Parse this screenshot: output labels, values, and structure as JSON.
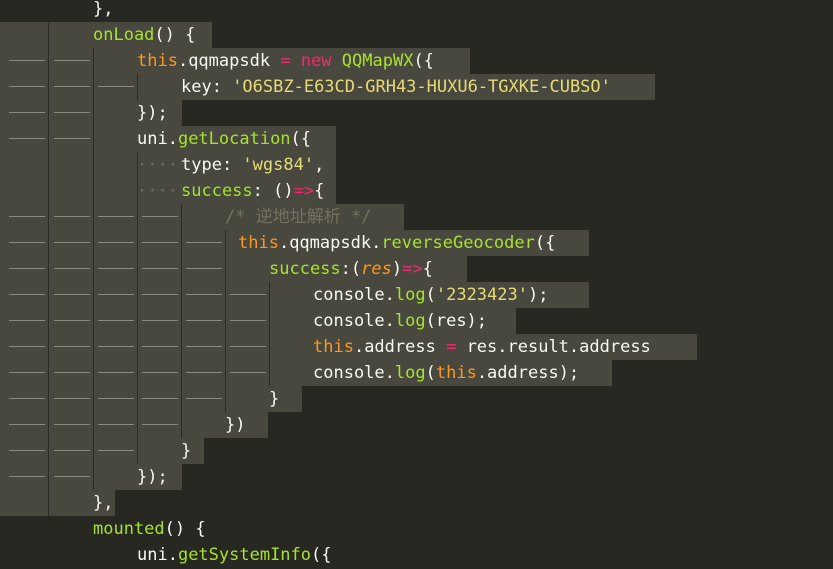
{
  "editor": {
    "colors": {
      "background": "#272822",
      "selection": "#49483e",
      "keyword": "#f92672",
      "function": "#a6e22e",
      "string": "#e6db74",
      "this": "#fd971f",
      "comment": "#75715e",
      "text": "#f8f8f2"
    },
    "lines": [
      [
        {
          "t": "},",
          "k": "pl"
        }
      ],
      [
        {
          "t": "onLoad",
          "k": "fn"
        },
        {
          "t": "() {",
          "k": "pl"
        }
      ],
      [
        {
          "t": "this",
          "k": "th"
        },
        {
          "t": ".qqmapsdk ",
          "k": "pl"
        },
        {
          "t": "=",
          "k": "kw"
        },
        {
          "t": " ",
          "k": "pl"
        },
        {
          "t": "new",
          "k": "kw"
        },
        {
          "t": " ",
          "k": "pl"
        },
        {
          "t": "QQMapWX",
          "k": "fn"
        },
        {
          "t": "({",
          "k": "pl"
        }
      ],
      [
        {
          "t": "key: ",
          "k": "pl"
        },
        {
          "t": "'O6SBZ-E63CD-GRH43-HUXU6-TGXKE-CUBSO'",
          "k": "str"
        }
      ],
      [
        {
          "t": "});",
          "k": "pl"
        }
      ],
      [
        {
          "t": "uni.",
          "k": "pl"
        },
        {
          "t": "getLocation",
          "k": "fn"
        },
        {
          "t": "({",
          "k": "pl"
        }
      ],
      [
        {
          "t": "type: ",
          "k": "pl"
        },
        {
          "t": "'wgs84'",
          "k": "str"
        },
        {
          "t": ",",
          "k": "pl"
        }
      ],
      [
        {
          "t": "success",
          "k": "fn"
        },
        {
          "t": ": ()",
          "k": "pl"
        },
        {
          "t": "=>",
          "k": "kw"
        },
        {
          "t": "{",
          "k": "pl"
        }
      ],
      [
        {
          "t": "/* 逆地址解析 */",
          "k": "cm"
        }
      ],
      [
        {
          "t": "this",
          "k": "th"
        },
        {
          "t": ".qqmapsdk.",
          "k": "pl"
        },
        {
          "t": "reverseGeocoder",
          "k": "fn"
        },
        {
          "t": "({",
          "k": "pl"
        }
      ],
      [
        {
          "t": "success",
          "k": "fn"
        },
        {
          "t": ":(",
          "k": "pl"
        },
        {
          "t": "res",
          "k": "prm"
        },
        {
          "t": ")",
          "k": "pl"
        },
        {
          "t": "=>",
          "k": "kw"
        },
        {
          "t": "{",
          "k": "pl"
        }
      ],
      [
        {
          "t": "console.",
          "k": "pl"
        },
        {
          "t": "log",
          "k": "fn"
        },
        {
          "t": "(",
          "k": "pl"
        },
        {
          "t": "'2323423'",
          "k": "str"
        },
        {
          "t": ");",
          "k": "pl"
        }
      ],
      [
        {
          "t": "console.",
          "k": "pl"
        },
        {
          "t": "log",
          "k": "fn"
        },
        {
          "t": "(res);",
          "k": "pl"
        }
      ],
      [
        {
          "t": "this",
          "k": "th"
        },
        {
          "t": ".address ",
          "k": "pl"
        },
        {
          "t": "=",
          "k": "kw"
        },
        {
          "t": " res.result.address",
          "k": "pl"
        }
      ],
      [
        {
          "t": "console.",
          "k": "pl"
        },
        {
          "t": "log",
          "k": "fn"
        },
        {
          "t": "(",
          "k": "pl"
        },
        {
          "t": "this",
          "k": "th"
        },
        {
          "t": ".address);",
          "k": "pl"
        }
      ],
      [
        {
          "t": "}",
          "k": "pl"
        }
      ],
      [
        {
          "t": "})",
          "k": "pl"
        }
      ],
      [
        {
          "t": "}",
          "k": "pl"
        }
      ],
      [
        {
          "t": "});",
          "k": "pl"
        }
      ],
      [
        {
          "t": "},",
          "k": "pl"
        }
      ],
      [
        {
          "t": "mounted",
          "k": "fn"
        },
        {
          "t": "() {",
          "k": "pl"
        }
      ],
      [
        {
          "t": "uni.",
          "k": "pl"
        },
        {
          "t": "getSystemInfo",
          "k": "fn"
        },
        {
          "t": "({",
          "k": "pl"
        }
      ]
    ]
  }
}
